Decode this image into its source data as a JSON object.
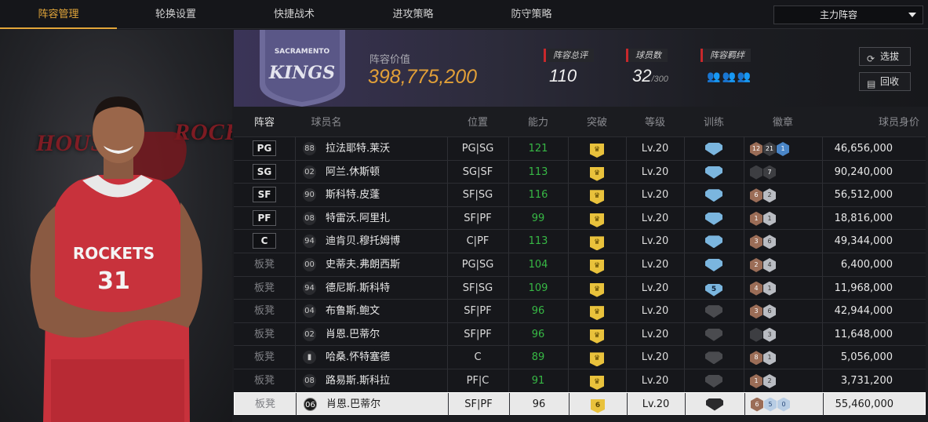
{
  "nav": {
    "tabs": [
      {
        "label": "阵容管理",
        "active": true
      },
      {
        "label": "轮换设置",
        "active": false
      },
      {
        "label": "快捷战术",
        "active": false
      },
      {
        "label": "进攻策略",
        "active": false
      },
      {
        "label": "防守策略",
        "active": false
      }
    ],
    "lineup_select": "主力阵容"
  },
  "player_art": {
    "jersey_team": "ROCKETS",
    "jersey_number": "31",
    "bg_text_left": "HOUST",
    "bg_text_right": "ROCK"
  },
  "team": {
    "logo_text_top": "SACRAMENTO",
    "logo_text_main": "KINGS"
  },
  "header": {
    "value_label": "阵容价值",
    "value": "398,775,200",
    "rating_label": "阵容总评",
    "rating": "110",
    "players_label": "球员数",
    "players_count": "32",
    "players_max": "/300",
    "bond_label": "阵容羁绊",
    "select_btn": "选拔",
    "recycle_btn": "回收"
  },
  "table": {
    "headers": [
      "阵容",
      "球员名",
      "位置",
      "能力",
      "突破",
      "等级",
      "训练",
      "徽章",
      "球员身价"
    ],
    "rows": [
      {
        "slot": "PG",
        "starter": true,
        "num": "88",
        "name": "拉法耶特.莱沃",
        "pos": "PG|SG",
        "ability": "121",
        "level": "Lv.20",
        "train": "blue",
        "train_val": "",
        "badges": [
          [
            "bronze",
            "12"
          ],
          [
            "dark",
            "21"
          ],
          [
            "blue",
            "1"
          ]
        ],
        "price": "46,656,000"
      },
      {
        "slot": "SG",
        "starter": true,
        "num": "02",
        "name": "阿兰.休斯顿",
        "pos": "SG|SF",
        "ability": "113",
        "level": "Lv.20",
        "train": "blue",
        "train_val": "",
        "badges": [
          [
            "dark",
            ""
          ],
          [
            "dark",
            "7"
          ]
        ],
        "price": "90,240,000"
      },
      {
        "slot": "SF",
        "starter": true,
        "num": "90",
        "name": "斯科特.皮蓬",
        "pos": "SF|SG",
        "ability": "116",
        "level": "Lv.20",
        "train": "blue",
        "train_val": "",
        "badges": [
          [
            "bronze",
            "6"
          ],
          [
            "silver",
            "2"
          ]
        ],
        "price": "56,512,000"
      },
      {
        "slot": "PF",
        "starter": true,
        "num": "08",
        "name": "特雷沃.阿里扎",
        "pos": "SF|PF",
        "ability": "99",
        "level": "Lv.20",
        "train": "blue",
        "train_val": "",
        "badges": [
          [
            "bronze",
            "1"
          ],
          [
            "silver",
            "1"
          ]
        ],
        "price": "18,816,000"
      },
      {
        "slot": "C",
        "starter": true,
        "num": "94",
        "name": "迪肯贝.穆托姆博",
        "pos": "C|PF",
        "ability": "113",
        "level": "Lv.20",
        "train": "blue",
        "train_val": "",
        "badges": [
          [
            "bronze",
            "3"
          ],
          [
            "silver",
            "6"
          ]
        ],
        "price": "49,344,000"
      },
      {
        "slot": "板凳",
        "starter": false,
        "num": "00",
        "name": "史蒂夫.弗朗西斯",
        "pos": "PG|SG",
        "ability": "104",
        "level": "Lv.20",
        "train": "blue",
        "train_val": "",
        "badges": [
          [
            "bronze",
            "2"
          ],
          [
            "silver",
            "4"
          ]
        ],
        "price": "6,400,000"
      },
      {
        "slot": "板凳",
        "starter": false,
        "num": "94",
        "name": "德尼斯.斯科特",
        "pos": "SF|SG",
        "ability": "109",
        "level": "Lv.20",
        "train": "blue",
        "train_val": "5",
        "badges": [
          [
            "bronze",
            "4"
          ],
          [
            "silver",
            "1"
          ]
        ],
        "price": "11,968,000"
      },
      {
        "slot": "板凳",
        "starter": false,
        "num": "04",
        "name": "布鲁斯.鲍文",
        "pos": "SF|PF",
        "ability": "96",
        "level": "Lv.20",
        "train": "dark",
        "train_val": "",
        "badges": [
          [
            "bronze",
            "3"
          ],
          [
            "silver",
            "6"
          ]
        ],
        "price": "42,944,000"
      },
      {
        "slot": "板凳",
        "starter": false,
        "num": "02",
        "name": "肖恩.巴蒂尔",
        "pos": "SF|PF",
        "ability": "96",
        "level": "Lv.20",
        "train": "dark",
        "train_val": "",
        "badges": [
          [
            "dark",
            ""
          ],
          [
            "silver",
            "3"
          ]
        ],
        "price": "11,648,000"
      },
      {
        "slot": "板凳",
        "starter": false,
        "num": "",
        "name": "哈桑.怀特塞德",
        "pos": "C",
        "ability": "89",
        "level": "Lv.20",
        "train": "dark",
        "train_val": "",
        "badges": [
          [
            "bronze",
            "8"
          ],
          [
            "silver",
            "1"
          ]
        ],
        "price": "5,056,000"
      },
      {
        "slot": "板凳",
        "starter": false,
        "num": "08",
        "name": "路易斯.斯科拉",
        "pos": "PF|C",
        "ability": "91",
        "level": "Lv.20",
        "train": "dark",
        "train_val": "",
        "badges": [
          [
            "bronze",
            "1"
          ],
          [
            "silver",
            "2"
          ]
        ],
        "price": "3,731,200"
      },
      {
        "slot": "板凳",
        "starter": false,
        "num": "06",
        "name": "肖恩.巴蒂尔",
        "pos": "SF|PF",
        "ability": "96",
        "level": "Lv.20",
        "train": "black",
        "train_val": "",
        "breakthrough": "6",
        "badges": [
          [
            "bronze",
            "6"
          ],
          [
            "lblue",
            "5"
          ],
          [
            "lblue",
            "0"
          ]
        ],
        "price": "55,460,000",
        "selected": true
      }
    ]
  }
}
